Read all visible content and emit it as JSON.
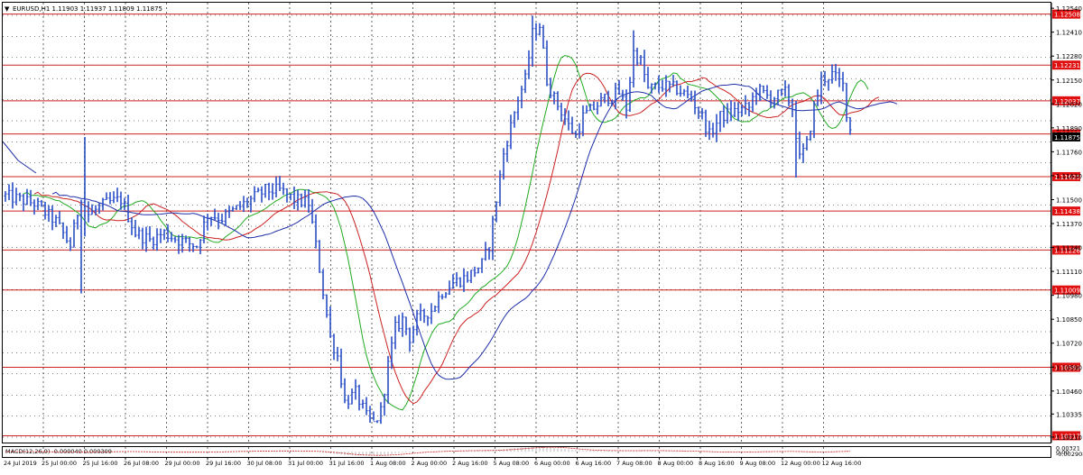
{
  "header": {
    "symbol_info": "EURUSD,H1  1.11903 1.11937 1.11809 1.11875",
    "collapse_glyph": "▼"
  },
  "colors": {
    "background": "#ffffff",
    "frame": "#000000",
    "grid": "#000000",
    "bars": "#2a4fc8",
    "level_line": "#cc2222",
    "level_label_bg": "#e01010",
    "ma_fast": "#22aa22",
    "ma_mid": "#cc2222",
    "ma_slow": "#1f2fa8",
    "macd_hist": "#b8b8b8",
    "macd_signal": "#cc2222",
    "price_label_bg": "#000000"
  },
  "chart_data": [
    {
      "type": "candlestick",
      "symbol": "EURUSD",
      "timeframe": "H1",
      "ohlc_header": {
        "open": 1.11903,
        "high": 1.11937,
        "low": 1.11809,
        "close": 1.11875
      },
      "ylim": [
        1.1018,
        1.1257
      ],
      "y_ticks": [
        "1.12540",
        "1.12410",
        "1.12280",
        "1.12150",
        "1.12020",
        "1.11890",
        "1.11760",
        "1.11630",
        "1.11500",
        "1.11370",
        "1.11240",
        "1.11110",
        "1.10980",
        "1.10850",
        "1.10720",
        "1.10590",
        "1.10460",
        "1.10335",
        "1.10210"
      ],
      "current_price_label": "1.11875",
      "horizontal_levels": [
        {
          "value": 1.12508,
          "label": "1.12508"
        },
        {
          "value": 1.12231,
          "label": "1.12231"
        },
        {
          "value": 1.12037,
          "label": "1.12037"
        },
        {
          "value": 1.11857,
          "label": "1.11857"
        },
        {
          "value": 1.11625,
          "label": "1.11625"
        },
        {
          "value": 1.11438,
          "label": "1.11438"
        },
        {
          "value": 1.11226,
          "label": "1.11226"
        },
        {
          "value": 1.11009,
          "label": "1.11009"
        },
        {
          "value": 1.10589,
          "label": "1.10589"
        },
        {
          "value": 1.10217,
          "label": "1.10217"
        }
      ],
      "x_labels": [
        "24 Jul 2019",
        "25 Jul 00:00",
        "25 Jul 16:00",
        "26 Jul 08:00",
        "29 Jul 00:00",
        "29 Jul 16:00",
        "30 Jul 08:00",
        "31 Jul 00:00",
        "31 Jul 16:00",
        "1 Aug 08:00",
        "2 Aug 00:00",
        "2 Aug 16:00",
        "5 Aug 08:00",
        "6 Aug 00:00",
        "6 Aug 16:00",
        "7 Aug 08:00",
        "8 Aug 00:00",
        "8 Aug 16:00",
        "9 Aug 08:00",
        "12 Aug 00:00",
        "12 Aug 16:00"
      ],
      "price_path": [
        {
          "bar": 0,
          "price": 1.1152
        },
        {
          "bar": 8,
          "price": 1.1148
        },
        {
          "bar": 14,
          "price": 1.1138
        },
        {
          "bar": 18,
          "price": 1.1125
        },
        {
          "bar": 21,
          "price": 1.1152
        },
        {
          "bar": 23,
          "price": 1.1142
        },
        {
          "bar": 28,
          "price": 1.1148
        },
        {
          "bar": 32,
          "price": 1.115
        },
        {
          "bar": 36,
          "price": 1.1132
        },
        {
          "bar": 40,
          "price": 1.1128
        },
        {
          "bar": 44,
          "price": 1.1132
        },
        {
          "bar": 48,
          "price": 1.1128
        },
        {
          "bar": 53,
          "price": 1.1125
        },
        {
          "bar": 56,
          "price": 1.1142
        },
        {
          "bar": 60,
          "price": 1.114
        },
        {
          "bar": 64,
          "price": 1.1145
        },
        {
          "bar": 68,
          "price": 1.115
        },
        {
          "bar": 72,
          "price": 1.1155
        },
        {
          "bar": 76,
          "price": 1.1155
        },
        {
          "bar": 80,
          "price": 1.115
        },
        {
          "bar": 84,
          "price": 1.1148
        },
        {
          "bar": 86,
          "price": 1.1125
        },
        {
          "bar": 88,
          "price": 1.11
        },
        {
          "bar": 90,
          "price": 1.1075
        },
        {
          "bar": 92,
          "price": 1.1065
        },
        {
          "bar": 94,
          "price": 1.104
        },
        {
          "bar": 97,
          "price": 1.1045
        },
        {
          "bar": 100,
          "price": 1.1032
        },
        {
          "bar": 102,
          "price": 1.1028
        },
        {
          "bar": 104,
          "price": 1.1035
        },
        {
          "bar": 106,
          "price": 1.106
        },
        {
          "bar": 108,
          "price": 1.108
        },
        {
          "bar": 110,
          "price": 1.1085
        },
        {
          "bar": 112,
          "price": 1.1075
        },
        {
          "bar": 114,
          "price": 1.1085
        },
        {
          "bar": 118,
          "price": 1.109
        },
        {
          "bar": 121,
          "price": 1.11
        },
        {
          "bar": 124,
          "price": 1.1105
        },
        {
          "bar": 128,
          "price": 1.1108
        },
        {
          "bar": 132,
          "price": 1.1115
        },
        {
          "bar": 134,
          "price": 1.1125
        },
        {
          "bar": 136,
          "price": 1.115
        },
        {
          "bar": 138,
          "price": 1.1175
        },
        {
          "bar": 140,
          "price": 1.119
        },
        {
          "bar": 142,
          "price": 1.1205
        },
        {
          "bar": 144,
          "price": 1.1215
        },
        {
          "bar": 146,
          "price": 1.124
        },
        {
          "bar": 148,
          "price": 1.1245
        },
        {
          "bar": 150,
          "price": 1.1215
        },
        {
          "bar": 152,
          "price": 1.1205
        },
        {
          "bar": 154,
          "price": 1.1198
        },
        {
          "bar": 156,
          "price": 1.119
        },
        {
          "bar": 158,
          "price": 1.1185
        },
        {
          "bar": 160,
          "price": 1.1195
        },
        {
          "bar": 163,
          "price": 1.12
        },
        {
          "bar": 166,
          "price": 1.1205
        },
        {
          "bar": 170,
          "price": 1.1208
        },
        {
          "bar": 172,
          "price": 1.12
        },
        {
          "bar": 174,
          "price": 1.123
        },
        {
          "bar": 176,
          "price": 1.1225
        },
        {
          "bar": 178,
          "price": 1.121
        },
        {
          "bar": 182,
          "price": 1.1212
        },
        {
          "bar": 186,
          "price": 1.121
        },
        {
          "bar": 190,
          "price": 1.1205
        },
        {
          "bar": 193,
          "price": 1.1195
        },
        {
          "bar": 195,
          "price": 1.1185
        },
        {
          "bar": 198,
          "price": 1.1195
        },
        {
          "bar": 202,
          "price": 1.1198
        },
        {
          "bar": 206,
          "price": 1.12
        },
        {
          "bar": 208,
          "price": 1.121
        },
        {
          "bar": 212,
          "price": 1.1205
        },
        {
          "bar": 216,
          "price": 1.1208
        },
        {
          "bar": 218,
          "price": 1.12
        },
        {
          "bar": 220,
          "price": 1.1172
        },
        {
          "bar": 222,
          "price": 1.118
        },
        {
          "bar": 224,
          "price": 1.12
        },
        {
          "bar": 226,
          "price": 1.1215
        },
        {
          "bar": 229,
          "price": 1.1218
        },
        {
          "bar": 232,
          "price": 1.1212
        },
        {
          "bar": 233,
          "price": 1.1198
        },
        {
          "bar": 234,
          "price": 1.1188
        }
      ],
      "moving_averages": [
        {
          "color": "green",
          "period_hint": "fast"
        },
        {
          "color": "red",
          "period_hint": "medium"
        },
        {
          "color": "blue",
          "period_hint": "slow"
        }
      ]
    },
    {
      "type": "macd",
      "label": "MACD(12,26,9) -0.000040 0.000309",
      "y_ticks": [
        "0.00321",
        "0.00",
        "-0.002908"
      ],
      "ylim": [
        -0.0033,
        0.0034
      ],
      "zero_value": 0
    }
  ]
}
